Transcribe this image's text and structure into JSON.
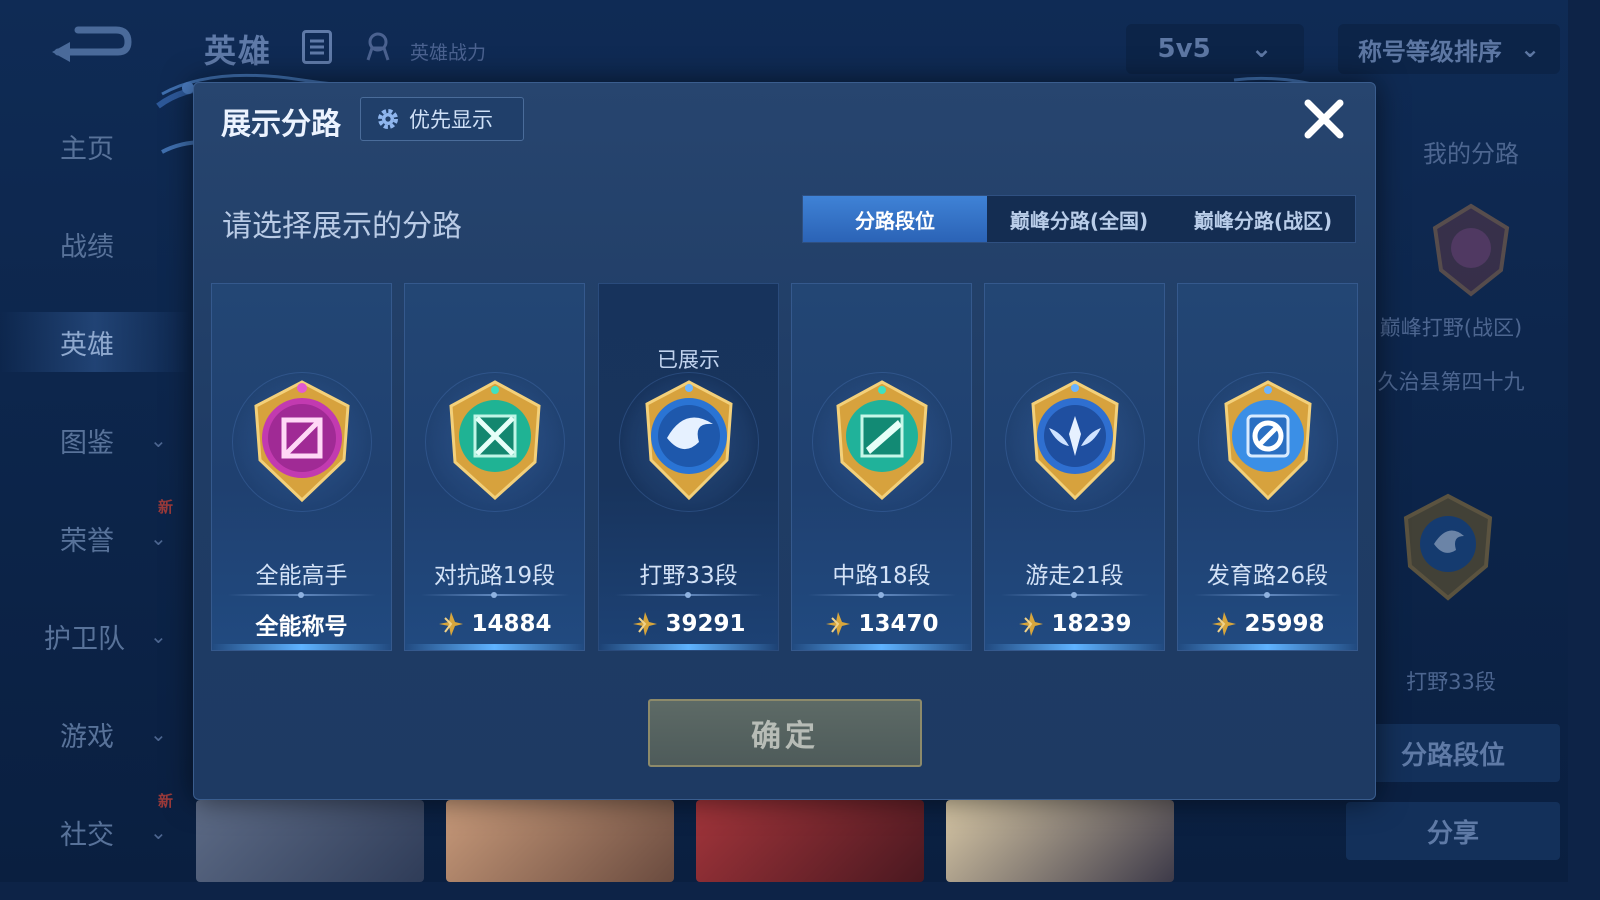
{
  "background": {
    "topbar": {
      "title": "英雄",
      "power_label": "英雄战力",
      "mode_value": "5v5",
      "sort_value": "称号等级排序"
    },
    "sidebar": {
      "items": [
        {
          "label": "主页",
          "has_chevron": false,
          "new_badge": ""
        },
        {
          "label": "战绩",
          "has_chevron": false,
          "new_badge": ""
        },
        {
          "label": "英雄",
          "has_chevron": false,
          "new_badge": "",
          "active": true
        },
        {
          "label": "图鉴",
          "has_chevron": true,
          "new_badge": ""
        },
        {
          "label": "荣誉",
          "has_chevron": true,
          "new_badge": "新"
        },
        {
          "label": "护卫队",
          "has_chevron": true,
          "new_badge": ""
        },
        {
          "label": "游戏",
          "has_chevron": true,
          "new_badge": ""
        },
        {
          "label": "社交",
          "has_chevron": true,
          "new_badge": "新"
        }
      ],
      "chevron_glyph": "⌄"
    },
    "right_panel": {
      "title": "我的分路",
      "peak_label": "巅峰打野(战区)",
      "region_label": "久治县第四十九",
      "lane_label": "打野33段",
      "lane_button": "分路段位",
      "share_button": "分享"
    }
  },
  "modal": {
    "title": "展示分路",
    "priority_button": "优先显示",
    "close_icon": "close-icon",
    "prompt": "请选择展示的分路",
    "tabs": [
      {
        "label": "分路段位",
        "active": true
      },
      {
        "label": "巅峰分路(全国)",
        "active": false
      },
      {
        "label": "巅峰分路(战区)",
        "active": false
      }
    ],
    "shown_label": "已展示",
    "cards": [
      {
        "name": "全能高手",
        "value": "全能称号",
        "shown": false,
        "color": "#c23ab0",
        "icon": "all-round-emblem-icon"
      },
      {
        "name": "对抗路19段",
        "value": "14884",
        "shown": false,
        "color": "#1fb394",
        "icon": "clash-lane-emblem-icon"
      },
      {
        "name": "打野33段",
        "value": "39291",
        "shown": true,
        "color": "#2a74d4",
        "icon": "jungle-emblem-icon"
      },
      {
        "name": "中路18段",
        "value": "13470",
        "shown": false,
        "color": "#20b29a",
        "icon": "mid-lane-emblem-icon"
      },
      {
        "name": "游走21段",
        "value": "18239",
        "shown": false,
        "color": "#2f6fd0",
        "icon": "roam-emblem-icon"
      },
      {
        "name": "发育路26段",
        "value": "25998",
        "shown": false,
        "color": "#3b8fe6",
        "icon": "farm-lane-emblem-icon"
      }
    ],
    "confirm_button": "确定"
  },
  "colors": {
    "accent": "#3f82d6",
    "gold": "#d8a63c",
    "panel": "#233f69"
  }
}
